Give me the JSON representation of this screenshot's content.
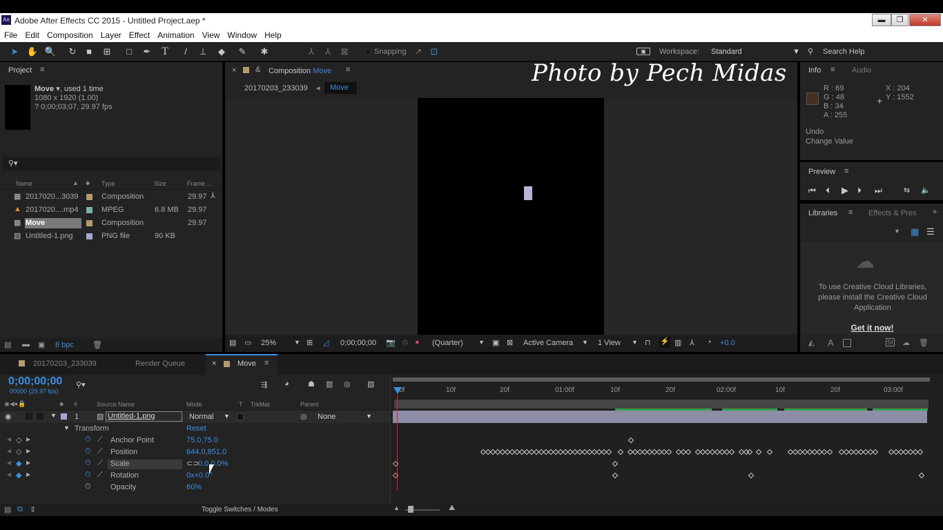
{
  "window": {
    "title": "Adobe After Effects CC 2015 - Untitled Project.aep *",
    "app_icon": "Ae",
    "minimize": "▬",
    "restore": "❐",
    "close": "✕"
  },
  "menu": [
    "File",
    "Edit",
    "Composition",
    "Layer",
    "Effect",
    "Animation",
    "View",
    "Window",
    "Help"
  ],
  "toolbar": {
    "snapping": "Snapping",
    "workspace_label": "Workspace:",
    "workspace_value": "Standard",
    "search_help": "Search Help"
  },
  "watermark": "Photo by Pech Midas",
  "project": {
    "title": "Project",
    "item_name": "Move",
    "item_used": ", used 1 time",
    "item_dims": "1080 x 1920 (1.00)",
    "item_duration": "? 0;00;03;07, 29.97 fps",
    "columns": {
      "name": "Name",
      "type": "Type",
      "size": "Size",
      "frame": "Frame ..."
    },
    "items": [
      {
        "name": "2017020...3039",
        "type": "Composition",
        "size": "",
        "frame": "29.97",
        "color": "#b59a6e"
      },
      {
        "name": "2017020....mp4",
        "type": "MPEG",
        "size": "6.8 MB",
        "frame": "29.97",
        "color": "#7fb0b0"
      },
      {
        "name": "Move",
        "type": "Composition",
        "size": "",
        "frame": "29.97",
        "color": "#b59a6e"
      },
      {
        "name": "Untitled-1.png",
        "type": "PNG file",
        "size": "90 KB",
        "frame": "",
        "color": "#a6a6d4"
      }
    ],
    "bpc": "8 bpc"
  },
  "composition": {
    "panel_label": "Composition",
    "comp_name": "Move",
    "breadcrumb_parent": "20170203_233039",
    "breadcrumb_current": "Move",
    "zoom": "25%",
    "timecode": "0;00;00;00",
    "resolution": "(Quarter)",
    "camera": "Active Camera",
    "views": "1 View",
    "exposure": "+0.0"
  },
  "info": {
    "tab_info": "Info",
    "tab_audio": "Audio",
    "r": "R : 69",
    "g": "G : 48",
    "b": "B : 34",
    "a": "A : 255",
    "x": "X : 204",
    "y": "Y : 1552",
    "color": "#452f22",
    "undo_line1": "Undo",
    "undo_line2": "Change Value"
  },
  "preview": {
    "title": "Preview"
  },
  "libraries": {
    "tab_libraries": "Libraries",
    "tab_effects": "Effects & Pres",
    "message": "To use Creative Cloud Libraries, please install the Creative Cloud Application",
    "link": "Get it now!"
  },
  "timeline": {
    "tabs": [
      "20170203_233039",
      "Render Queue",
      "Move"
    ],
    "timecode": "0;00;00;00",
    "fps": "00000 (29.97 fps)",
    "columns": {
      "source": "Source Name",
      "mode": "Mode",
      "t": "T",
      "trkmat": "TrkMat",
      "parent": "Parent"
    },
    "layer": {
      "index": "1",
      "name": "Untitled-1.png",
      "mode": "Normal",
      "parent": "None"
    },
    "transform_label": "Transform",
    "reset": "Reset",
    "properties": [
      {
        "name": "Anchor Point",
        "value": "75.0,75.0"
      },
      {
        "name": "Position",
        "value": "644.0,851.0"
      },
      {
        "name": "Scale",
        "value": "0.0,0.0%"
      },
      {
        "name": "Rotation",
        "value": "0x+0.0°"
      },
      {
        "name": "Opacity",
        "value": "60%"
      }
    ],
    "ruler": [
      "0f",
      "10f",
      "20f",
      "01:00f",
      "10f",
      "20f",
      "02:00f",
      "10f",
      "20f",
      "03:00f"
    ],
    "toggle": "Toggle Switches / Modes"
  }
}
